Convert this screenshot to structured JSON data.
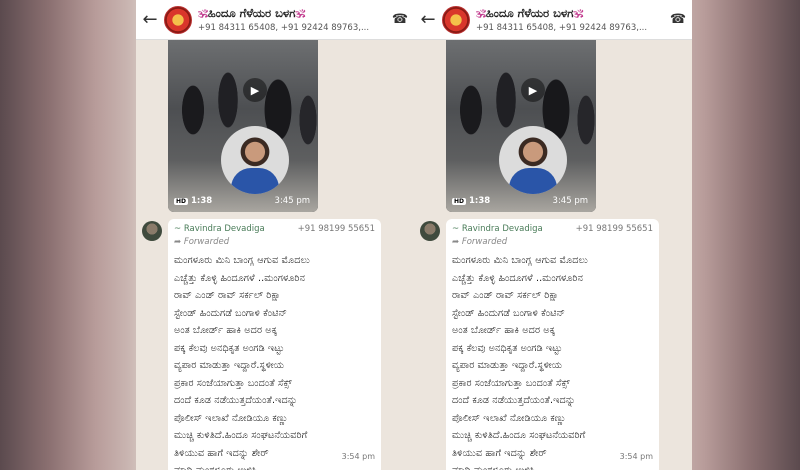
{
  "header": {
    "group_name": "ಹಿಂದೂ ಗೆಳೆಯರ ಬಳಗ",
    "om_glyph": "🕉",
    "members": "+91 84311 65408, +91 92424 89763,..."
  },
  "video": {
    "quality": "HD",
    "duration": "1:38",
    "time": "3:45 pm"
  },
  "message": {
    "sender": "~ Ravindra Devadiga",
    "phone": "+91 98199 55651",
    "forwarded": "Forwarded",
    "text": "ಮಂಗಳೂರು ಮಿನಿ ಬಾಂಗ್ಲ ಆಗುವ ಮೊದಲು\nಎಚ್ಚೆತ್ತು ಕೊಳ್ಳಿ ಹಿಂದೂಗಳೆ ..ಮಂಗಳೂರಿನ\nರಾವ್ ಎಂಡ್ ರಾವ್ ಸರ್ಕಲ್ ರಿಕ್ಷಾ\nಸ್ಟೇಂಡ್ ಹಿಂದುಗಡೆ ಬಂಗಾಳಿ ಕೆಂಟಿನ್\nಅಂತ ಬೋರ್ಡ್ ಹಾಕಿ ಅದರ ಅಕ್ಕ\nಪಕ್ಕ ಕೆಲವು ಅನಧಿಕೃತ ಅಂಗಡಿ ಇಟ್ಟು\nವ್ಯಪಾರ ಮಾಡುತ್ತಾ ಇದ್ದಾರೆ.ಸ್ಥಳೀಯ\nಪ್ರಕಾರ ಸಂಜೆಯಾಗುತ್ತಾ ಬಂದಂತೆ ಸೆಕ್ಸ್\nದಂದೆ ಕೂಡ ನಡೆಯುತ್ತದೆಯಂತೆ.ಇದನ್ನು\nಪೊಲೀಸ್ ಇಲಾಖೆ ನೋಡಿಯೂ ಕಣ್ಣು\nಮುಚ್ಚಿ ಕುಳಿತಿದೆ.ಹಿಂದೂ ಸಂಘಟನೆಯವರಿಗೆ\nತಿಳಿಯುವ ಹಾಗೆ ಇದನ್ನು ಶೇರ್\nಮಾಡಿ.ಮಂಗಳೂರು ಉಳಿಸಿ",
    "time": "3:54 pm"
  }
}
